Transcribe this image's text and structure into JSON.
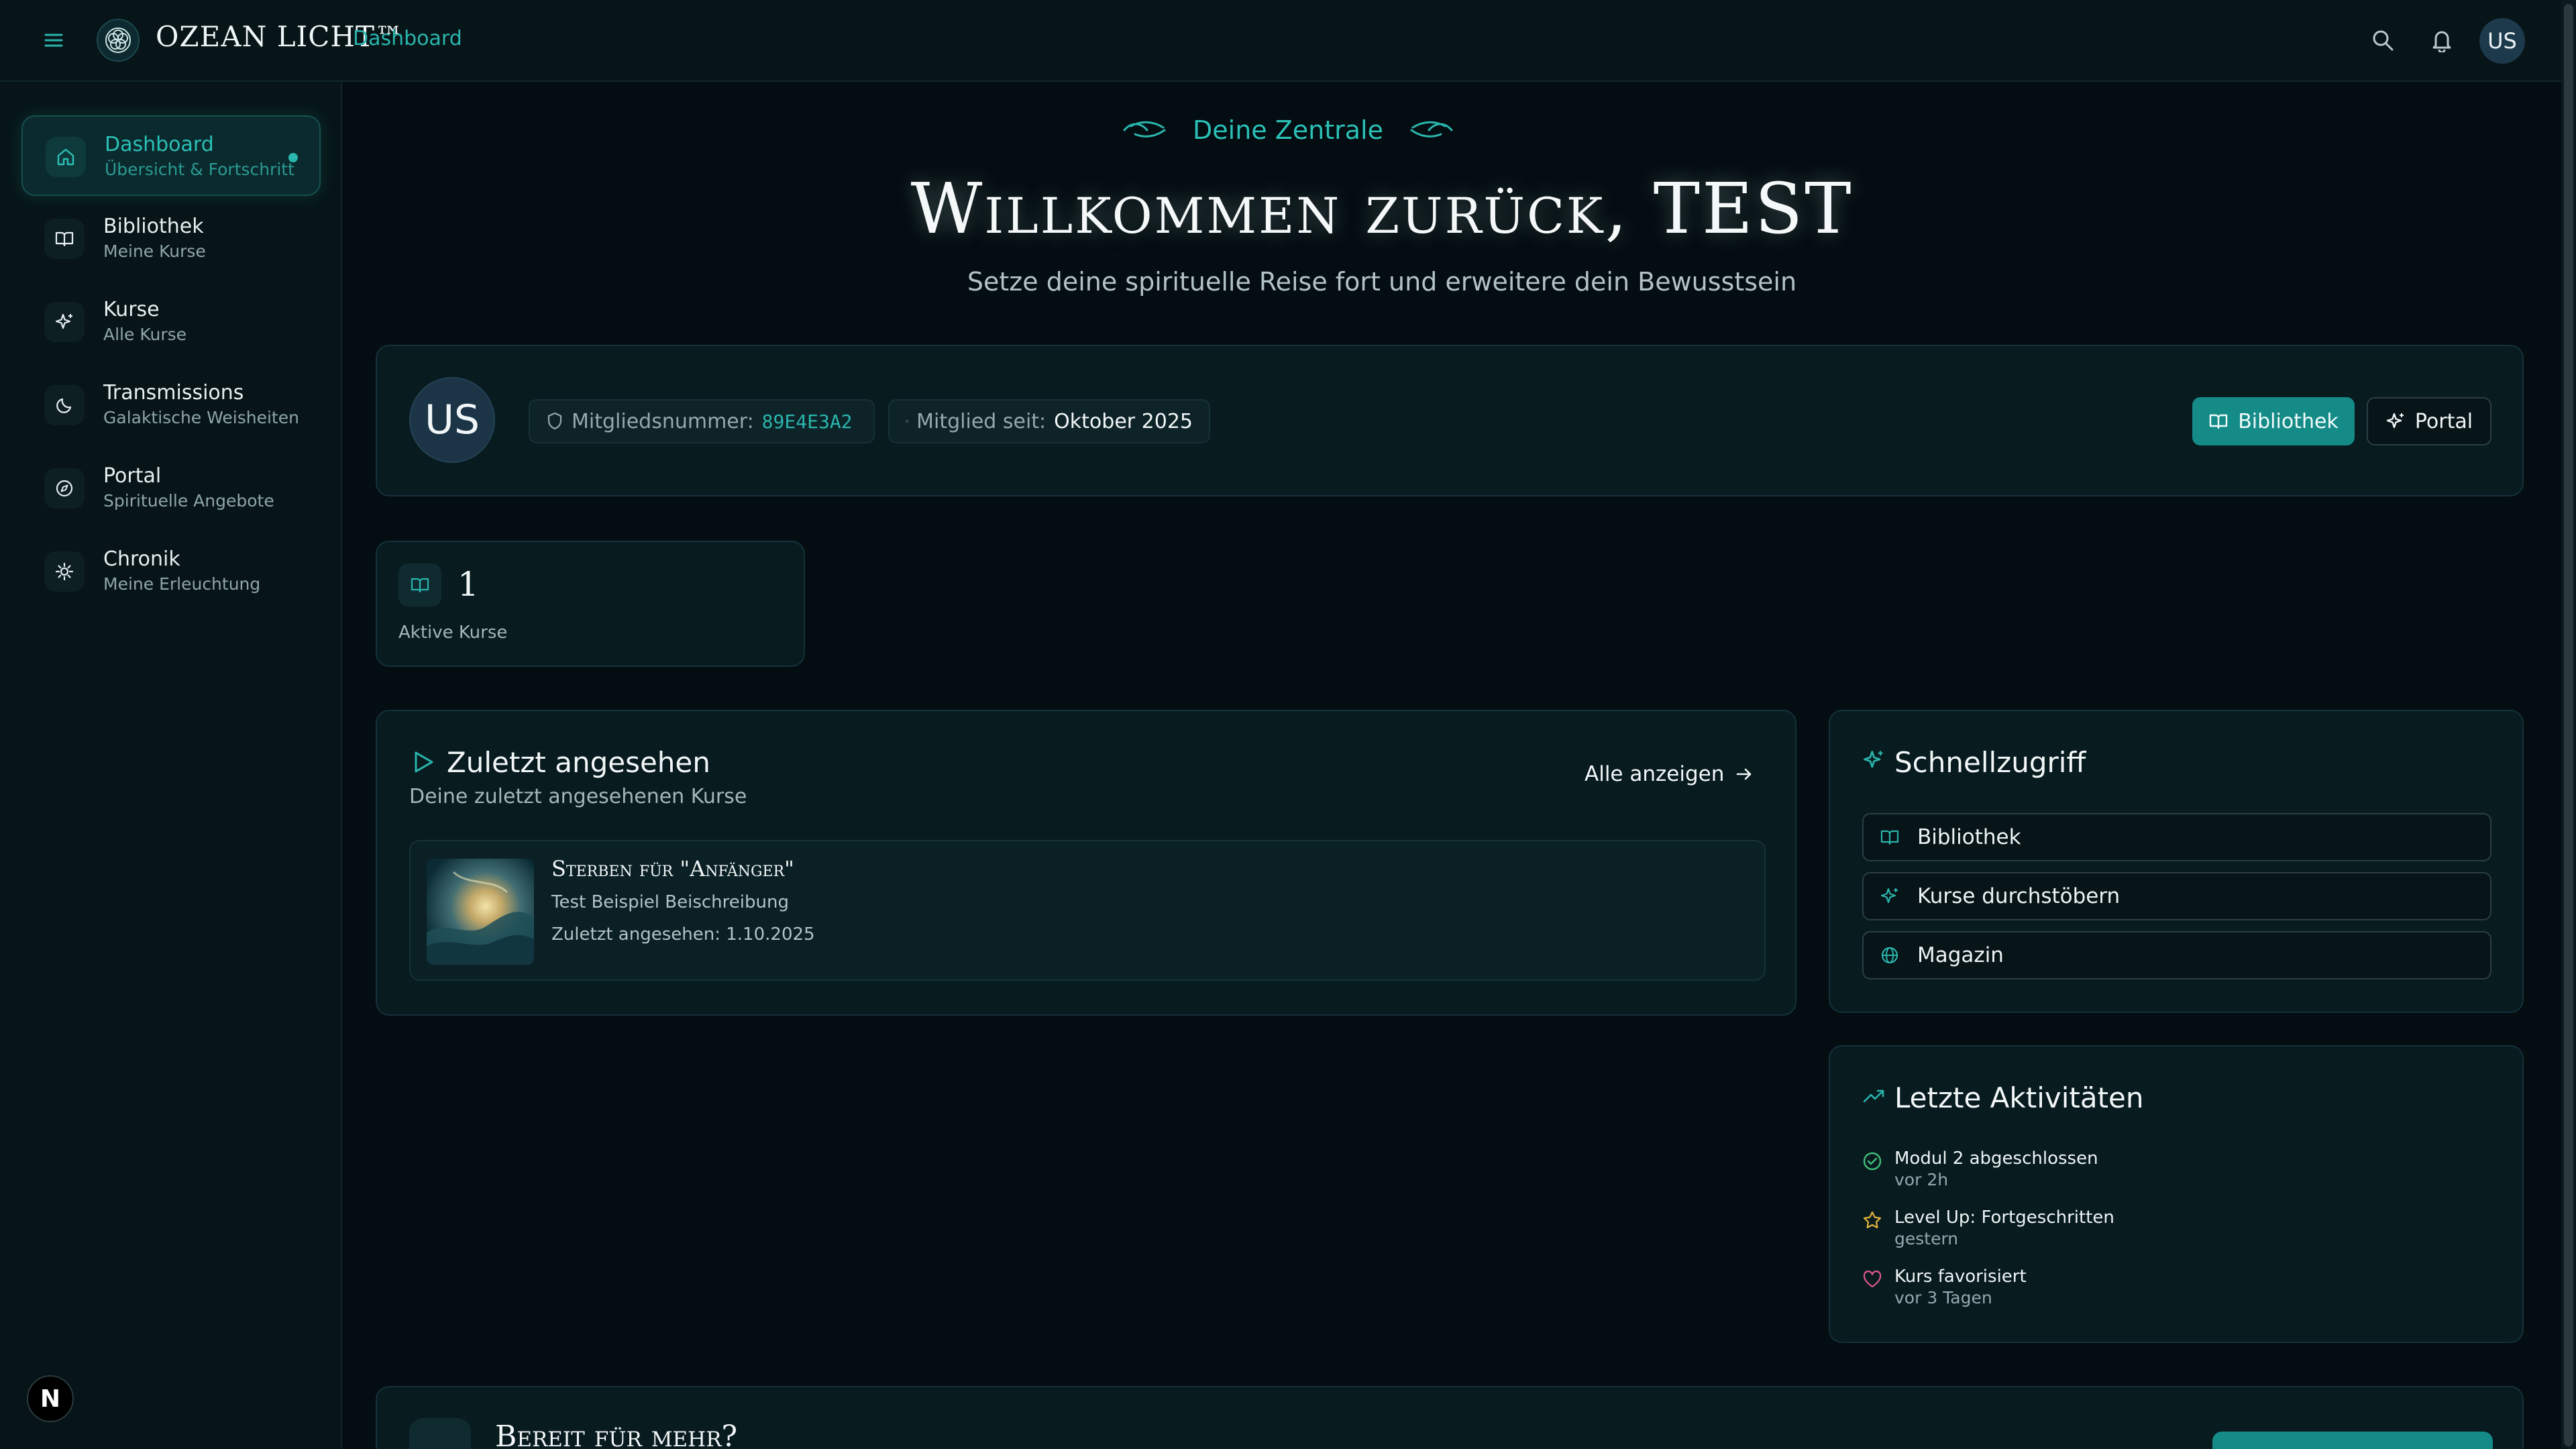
{
  "topbar": {
    "brand": "OZEAN LICHT™",
    "breadcrumb": "Dashboard",
    "avatar_initials": "US"
  },
  "sidebar": {
    "items": [
      {
        "label": "Dashboard",
        "sub": "Übersicht & Fortschritt",
        "icon": "home-icon",
        "active": true
      },
      {
        "label": "Bibliothek",
        "sub": "Meine Kurse",
        "icon": "book-icon"
      },
      {
        "label": "Kurse",
        "sub": "Alle Kurse",
        "icon": "sparkles-icon"
      },
      {
        "label": "Transmissions",
        "sub": "Galaktische Weisheiten",
        "icon": "moon-icon"
      },
      {
        "label": "Portal",
        "sub": "Spirituelle Angebote",
        "icon": "compass-icon"
      },
      {
        "label": "Chronik",
        "sub": "Meine Erleuchtung",
        "icon": "sun-icon"
      }
    ],
    "badge": "N"
  },
  "hero": {
    "eyebrow": "Deine Zentrale",
    "title": "Willkommen zurück, TEST",
    "subtitle": "Setze deine spirituelle Reise fort und erweitere dein Bewusstsein"
  },
  "member": {
    "initials": "US",
    "number_label": "Mitgliedsnummer:",
    "number_value": "89E4E3A2",
    "since_label": "Mitglied seit:",
    "since_value": "Oktober 2025",
    "btn_library": "Bibliothek",
    "btn_portal": "Portal"
  },
  "stats": {
    "value": "1",
    "label": "Aktive Kurse"
  },
  "recent": {
    "title": "Zuletzt angesehen",
    "subtitle": "Deine zuletzt angesehenen Kurse",
    "see_all": "Alle anzeigen",
    "course": {
      "title": "Sterben für \"Anfänger\"",
      "description": "Test Beispiel Beischreibung",
      "last_seen": "Zuletzt angesehen: 1.10.2025"
    }
  },
  "quick": {
    "title": "Schnellzugriff",
    "items": [
      "Bibliothek",
      "Kurse durchstöbern",
      "Magazin"
    ]
  },
  "activity": {
    "title": "Letzte Aktivitäten",
    "items": [
      {
        "title": "Modul 2 abgeschlossen",
        "time": "vor 2h",
        "icon": "check-circle-icon",
        "color": "#3fbf7a"
      },
      {
        "title": "Level Up: Fortgeschritten",
        "time": "gestern",
        "icon": "star-icon",
        "color": "#e6b43c"
      },
      {
        "title": "Kurs favorisiert",
        "time": "vor 3 Tagen",
        "icon": "heart-icon",
        "color": "#e05a8a"
      }
    ]
  },
  "more": {
    "title": "Bereit für mehr?"
  },
  "colors": {
    "accent": "#2ab5ad",
    "background": "#040d11",
    "button": "#158b88"
  }
}
